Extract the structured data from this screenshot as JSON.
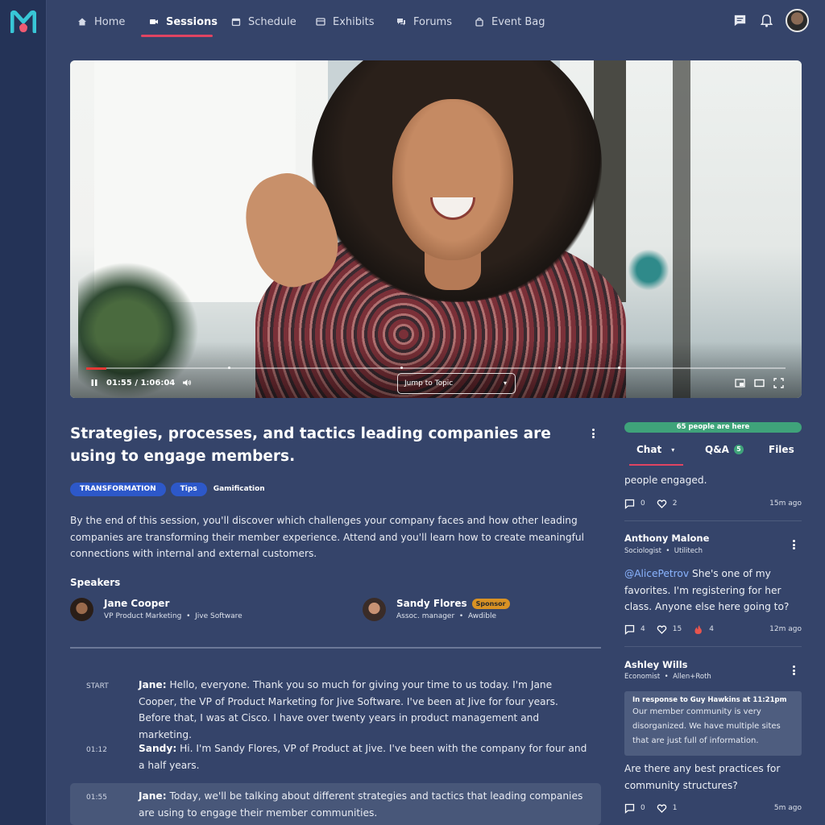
{
  "nav": {
    "items": [
      {
        "label": "Home",
        "icon": "home-icon"
      },
      {
        "label": "Sessions",
        "icon": "video-icon"
      },
      {
        "label": "Schedule",
        "icon": "calendar-icon"
      },
      {
        "label": "Exhibits",
        "icon": "exhibits-icon"
      },
      {
        "label": "Forums",
        "icon": "forum-icon"
      },
      {
        "label": "Event Bag",
        "icon": "bag-icon"
      }
    ],
    "active": "Sessions"
  },
  "colors": {
    "accent": "#e04462",
    "tag": "#2d58c9",
    "presence": "#3fa37a",
    "sponsor": "#d99224",
    "mention": "#8ab4ff"
  },
  "video": {
    "time_display": "01:55 / 1:06:04",
    "jump_label": "Jump to Topic",
    "progress_fraction": 0.029
  },
  "session": {
    "title": "Strategies, processes, and tactics leading companies are using to engage members.",
    "tags": [
      "TRANSFORMATION",
      "Tips",
      "Gamification"
    ],
    "description": "By the end of this session, you'll discover which challenges your company faces and how other leading companies are transforming their member experience.  Attend and you'll learn how to create meaningful connections with internal and external customers.",
    "speakers_heading": "Speakers",
    "speakers": [
      {
        "name": "Jane Cooper",
        "role": "VP Product Marketing",
        "company": "Jive Software",
        "badge": ""
      },
      {
        "name": "Sandy Flores",
        "role": "Assoc. manager",
        "company": "Awdible",
        "badge": "Sponsor"
      }
    ]
  },
  "transcript": [
    {
      "time": "START",
      "speaker": "Jane:",
      "text": " Hello, everyone. Thank you so much for giving your time to us today. I'm Jane Cooper, the VP of Product Marketing for Jive Software. I've been at Jive for four years. Before that, I was at Cisco. I have over twenty years in product management and marketing."
    },
    {
      "time": "01:12",
      "speaker": "Sandy:",
      "text": " Hi. I'm Sandy Flores, VP of Product at Jive. I've been with the company for four and a half years."
    },
    {
      "time": "01:55",
      "speaker": "Jane:",
      "text": " Today, we'll be talking about different strategies and tactics that leading companies are using to engage their member communities."
    }
  ],
  "panel": {
    "presence": "65 people are here",
    "tabs": [
      {
        "label": "Chat",
        "badge": ""
      },
      {
        "label": "Q&A",
        "badge": "5"
      },
      {
        "label": "Files",
        "badge": ""
      }
    ],
    "messages": [
      {
        "author": "",
        "role": "",
        "company": "",
        "mention": "",
        "text": "people engaged.",
        "comments": "0",
        "likes": "2",
        "fire": "",
        "ago": "15m ago"
      },
      {
        "author": "Anthony Malone",
        "role": "Sociologist",
        "company": "Utilitech",
        "mention": "@AlicePetrov",
        "text": " She's one of my favorites. I'm registering for her class. Anyone else here going to?",
        "comments": "4",
        "likes": "15",
        "fire": "4",
        "ago": "12m ago"
      },
      {
        "author": "Ashley Wills",
        "role": "Economist",
        "company": "Allen+Roth",
        "mention": "",
        "text": "Are there any best practices for community structures?",
        "comments": "0",
        "likes": "1",
        "fire": "",
        "ago": "5m ago",
        "quote_header": "In response to Guy Hawkins at 11:21pm",
        "quote_text": "Our member community is very disorganized. We have multiple sites that are just full of information."
      }
    ]
  }
}
